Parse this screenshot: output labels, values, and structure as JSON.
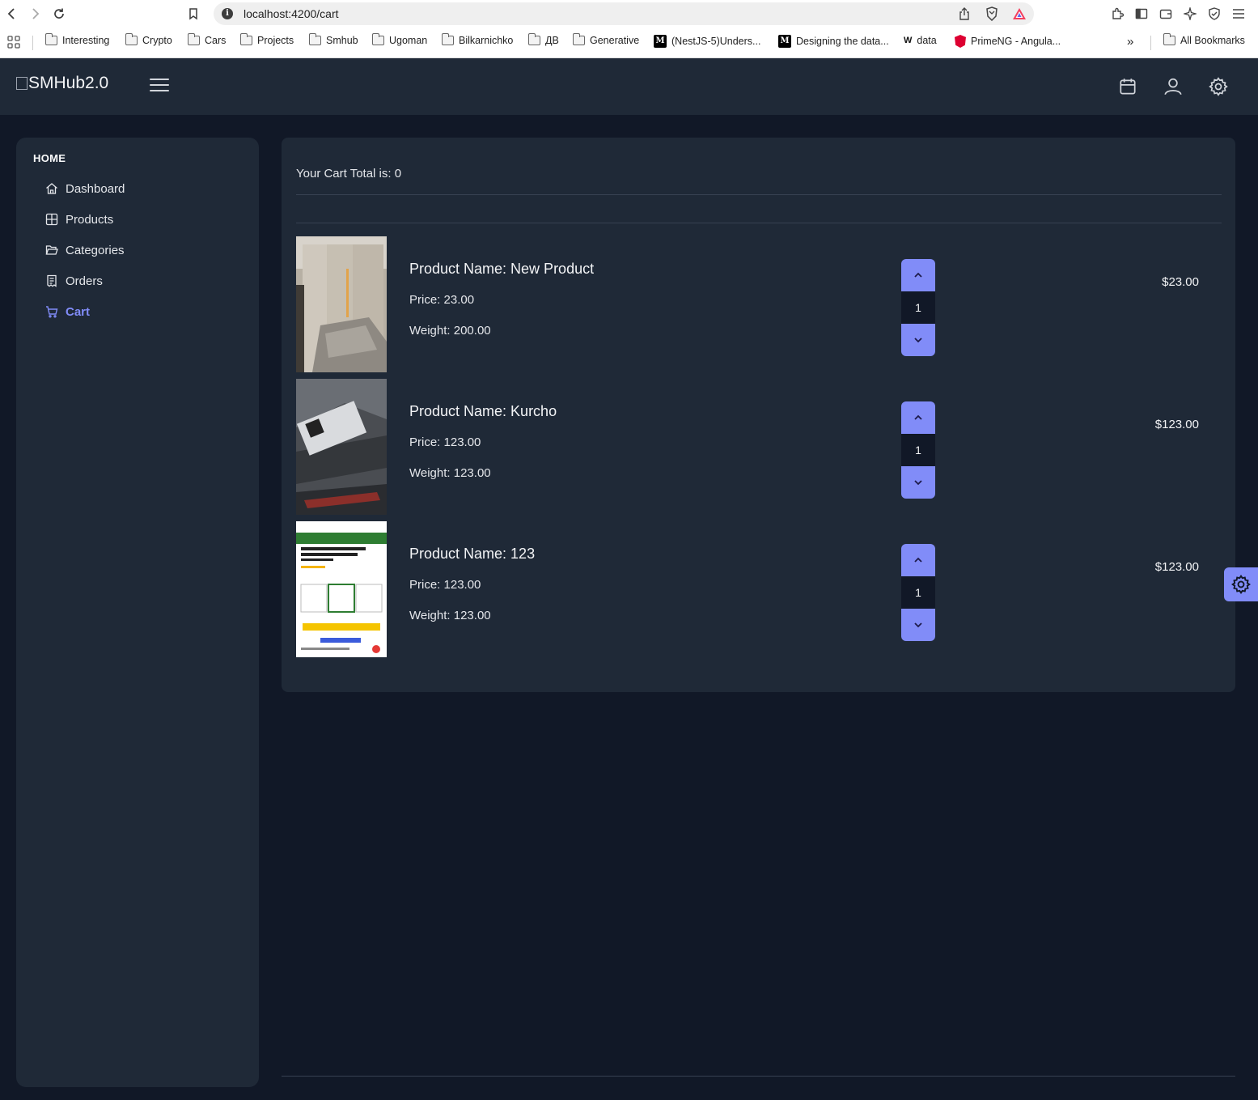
{
  "browser": {
    "url": "localhost:4200/cart",
    "bookmarks": [
      {
        "label": "Interesting",
        "icon": "folder-icon"
      },
      {
        "label": "Crypto",
        "icon": "folder-icon"
      },
      {
        "label": "Cars",
        "icon": "folder-icon"
      },
      {
        "label": "Projects",
        "icon": "folder-icon"
      },
      {
        "label": "Smhub",
        "icon": "folder-icon"
      },
      {
        "label": "Ugoman",
        "icon": "folder-icon"
      },
      {
        "label": "Bilkarnichko",
        "icon": "folder-icon"
      },
      {
        "label": "ДВ",
        "icon": "folder-icon"
      },
      {
        "label": "Generative",
        "icon": "folder-icon"
      },
      {
        "label": "(NestJS-5)Unders...",
        "icon": "medium-icon"
      },
      {
        "label": "Designing the data...",
        "icon": "medium-icon"
      },
      {
        "label": "data",
        "icon": "w-icon"
      },
      {
        "label": "PrimeNG - Angula...",
        "icon": "primeng-icon"
      }
    ],
    "all_bookmarks": "All Bookmarks",
    "overflow": "»"
  },
  "app": {
    "brand": "SMHub2.0"
  },
  "sidebar": {
    "heading": "HOME",
    "items": [
      {
        "label": "Dashboard",
        "icon": "home-icon"
      },
      {
        "label": "Products",
        "icon": "grid-icon"
      },
      {
        "label": "Categories",
        "icon": "folder-open-icon"
      },
      {
        "label": "Orders",
        "icon": "receipt-icon"
      },
      {
        "label": "Cart",
        "icon": "cart-icon",
        "active": true
      }
    ]
  },
  "cart": {
    "total_text": "Your Cart Total is: 0",
    "items": [
      {
        "name": "Product Name: New Product",
        "price": "Price: 23.00",
        "weight": "Weight: 200.00",
        "qty": "1",
        "subtotal": "$23.00"
      },
      {
        "name": "Product Name: Kurcho",
        "price": "Price: 123.00",
        "weight": "Weight: 123.00",
        "qty": "1",
        "subtotal": "$123.00"
      },
      {
        "name": "Product Name: 123",
        "price": "Price: 123.00",
        "weight": "Weight: 123.00",
        "qty": "1",
        "subtotal": "$123.00"
      }
    ]
  },
  "colors": {
    "accent": "#818cf8",
    "surface": "#1f2937",
    "background": "#111827"
  }
}
